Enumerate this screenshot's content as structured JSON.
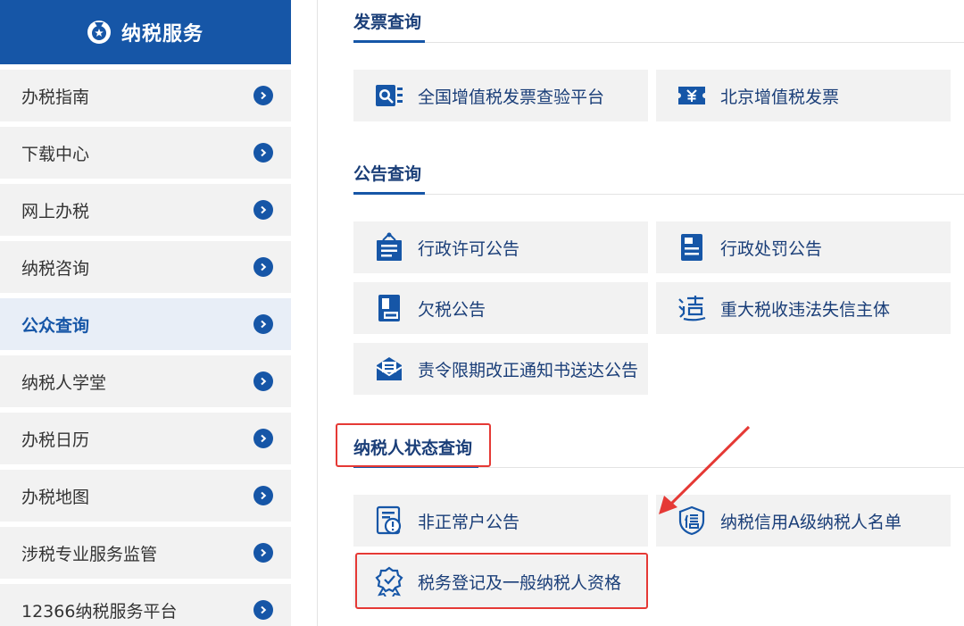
{
  "sidebar": {
    "title": "纳税服务",
    "items": [
      {
        "label": "办税指南"
      },
      {
        "label": "下载中心"
      },
      {
        "label": "网上办税"
      },
      {
        "label": "纳税咨询"
      },
      {
        "label": "公众查询"
      },
      {
        "label": "纳税人学堂"
      },
      {
        "label": "办税日历"
      },
      {
        "label": "办税地图"
      },
      {
        "label": "涉税专业服务监管"
      },
      {
        "label": "12366纳税服务平台"
      }
    ],
    "active_index": 4
  },
  "sections": [
    {
      "title": "发票查询",
      "tiles": [
        {
          "label": "全国增值税发票查验平台",
          "icon": "invoice-search-icon"
        },
        {
          "label": "北京增值税发票",
          "icon": "yuan-ticket-icon"
        }
      ]
    },
    {
      "title": "公告查询",
      "tiles": [
        {
          "label": "行政许可公告",
          "icon": "notice-board-icon"
        },
        {
          "label": "行政处罚公告",
          "icon": "penalty-document-icon"
        },
        {
          "label": "欠税公告",
          "icon": "tax-arrears-icon"
        },
        {
          "label": "重大税收违法失信主体",
          "icon": "violation-icon"
        },
        {
          "label": "责令限期改正通知书送达公告",
          "icon": "envelope-icon"
        }
      ]
    },
    {
      "title": "纳税人状态查询",
      "tiles": [
        {
          "label": "非正常户公告",
          "icon": "warning-document-icon"
        },
        {
          "label": "纳税信用A级纳税人名单",
          "icon": "credit-shield-icon"
        },
        {
          "label": "税务登记及一般纳税人资格",
          "icon": "badge-ribbon-icon"
        }
      ]
    }
  ],
  "colors": {
    "primary": "#1656a7",
    "text_dark": "#1a3e78",
    "tile_bg": "#f2f2f2",
    "highlight": "#e53935"
  }
}
